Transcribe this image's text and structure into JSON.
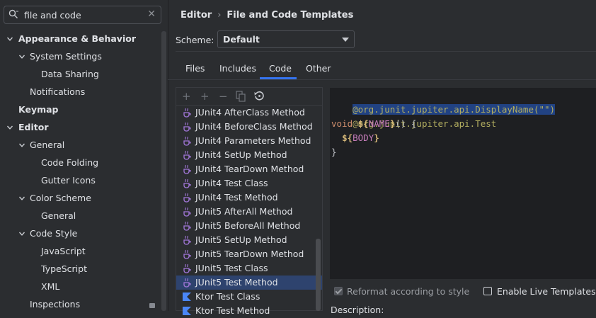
{
  "search": {
    "value": "file and code",
    "icon": "search-icon"
  },
  "sidebar": {
    "items": [
      {
        "label": "Appearance & Behavior",
        "level": 0,
        "expanded": true,
        "bold": true
      },
      {
        "label": "System Settings",
        "level": 1,
        "expanded": true
      },
      {
        "label": "Data Sharing",
        "level": 2
      },
      {
        "label": "Notifications",
        "level": 1
      },
      {
        "label": "Keymap",
        "level": 0,
        "bold": true
      },
      {
        "label": "Editor",
        "level": 0,
        "expanded": true,
        "bold": true
      },
      {
        "label": "General",
        "level": 1,
        "expanded": true
      },
      {
        "label": "Code Folding",
        "level": 2
      },
      {
        "label": "Gutter Icons",
        "level": 2
      },
      {
        "label": "Color Scheme",
        "level": 1,
        "expanded": true
      },
      {
        "label": "General",
        "level": 2
      },
      {
        "label": "Code Style",
        "level": 1,
        "expanded": true
      },
      {
        "label": "JavaScript",
        "level": 2
      },
      {
        "label": "TypeScript",
        "level": 2
      },
      {
        "label": "XML",
        "level": 2
      },
      {
        "label": "Inspections",
        "level": 1
      }
    ]
  },
  "header": {
    "breadcrumb_parent": "Editor",
    "breadcrumb_current": "File and Code Templates",
    "separator": "›"
  },
  "scheme": {
    "label": "Scheme:",
    "value": "Default"
  },
  "tabs": [
    {
      "label": "Files"
    },
    {
      "label": "Includes"
    },
    {
      "label": "Code",
      "active": true
    },
    {
      "label": "Other"
    }
  ],
  "toolbar": {
    "add": "+",
    "add_child": "+",
    "remove": "−",
    "copy": "copy-icon",
    "reset": "reset-icon"
  },
  "templates": [
    {
      "label": "JUnit4 AfterClass Method",
      "icon": "java-file-icon"
    },
    {
      "label": "JUnit4 BeforeClass Method",
      "icon": "java-file-icon"
    },
    {
      "label": "JUnit4 Parameters Method",
      "icon": "java-file-icon"
    },
    {
      "label": "JUnit4 SetUp Method",
      "icon": "java-file-icon"
    },
    {
      "label": "JUnit4 TearDown Method",
      "icon": "java-file-icon"
    },
    {
      "label": "JUnit4 Test Class",
      "icon": "java-file-icon"
    },
    {
      "label": "JUnit4 Test Method",
      "icon": "java-file-icon"
    },
    {
      "label": "JUnit5 AfterAll Method",
      "icon": "java-file-icon"
    },
    {
      "label": "JUnit5 BeforeAll Method",
      "icon": "java-file-icon"
    },
    {
      "label": "JUnit5 SetUp Method",
      "icon": "java-file-icon"
    },
    {
      "label": "JUnit5 TearDown Method",
      "icon": "java-file-icon"
    },
    {
      "label": "JUnit5 Test Class",
      "icon": "java-file-icon"
    },
    {
      "label": "JUnit5 Test Method",
      "icon": "java-file-icon",
      "selected": true
    },
    {
      "label": "Ktor Test Class",
      "icon": "kotlin-file-icon"
    },
    {
      "label": "Ktor Test Method",
      "icon": "kotlin-file-icon"
    }
  ],
  "code": {
    "line1": "@org.junit.jupiter.api.DisplayName(\"\")",
    "line2": "@org.junit.jupiter.api.Test",
    "line3_kw": "void",
    "line3_dollar": "${",
    "line3_var": "NAME",
    "line3_close": "}",
    "line3_rest": "() {",
    "line4_dollar": "${",
    "line4_var": "BODY",
    "line4_close": "}",
    "line5": "}"
  },
  "options": {
    "reformat_label": "Reformat according to style",
    "reformat_checked": true,
    "live_templates_label": "Enable Live Templates",
    "live_templates_checked": false,
    "description_label": "Description:"
  },
  "colors": {
    "accent": "#3574f0",
    "selection": "#2e436e",
    "editor_bg": "#1e1f22"
  }
}
